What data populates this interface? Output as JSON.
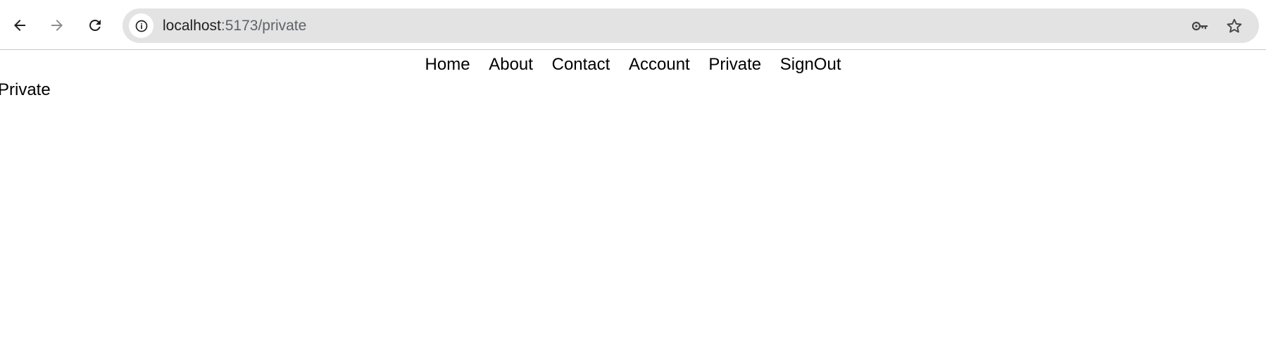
{
  "browser": {
    "url_host": "localhost",
    "url_path": ":5173/private",
    "icons": {
      "back": "arrow-left-icon",
      "forward": "arrow-right-icon",
      "reload": "reload-icon",
      "site_info": "info-icon",
      "passwords": "key-icon",
      "bookmark": "star-icon"
    }
  },
  "nav": {
    "items": [
      {
        "label": "Home"
      },
      {
        "label": "About"
      },
      {
        "label": "Contact"
      },
      {
        "label": "Account"
      },
      {
        "label": "Private"
      },
      {
        "label": "SignOut"
      }
    ]
  },
  "page": {
    "heading": "Private"
  }
}
